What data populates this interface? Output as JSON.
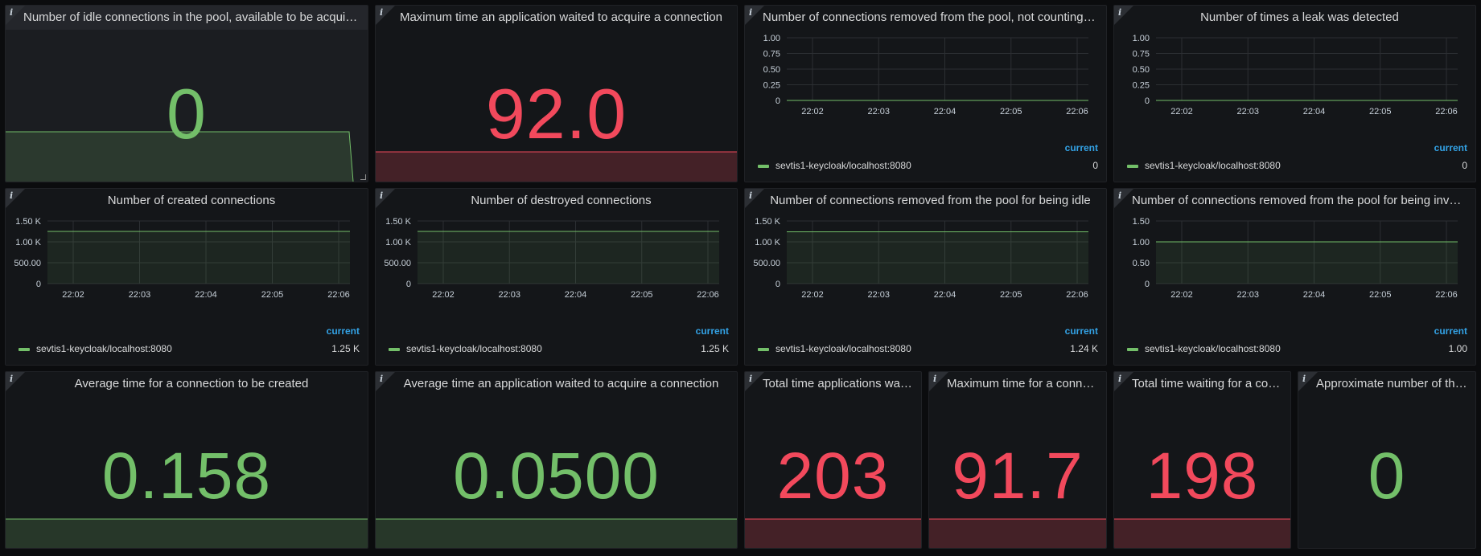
{
  "colors": {
    "green": "#73bf69",
    "red": "#f2495c",
    "blue_current": "#33a2e5"
  },
  "icons": {
    "info": "info-icon"
  },
  "common": {
    "info_glyph": "i",
    "legend_current": "current",
    "series_name": "sevtis1-keycloak/localhost:8080",
    "x_ticks": [
      "22:02",
      "22:03",
      "22:04",
      "22:05",
      "22:06"
    ]
  },
  "panels": {
    "idle": {
      "title": "Number of idle connections in the pool, available to be acquired",
      "value": "0",
      "color": "green",
      "sparkline_level_fraction": 0.0
    },
    "max_wait": {
      "title": "Maximum time an application waited to acquire a connection",
      "value": "92.0",
      "color": "red"
    },
    "removed_not_invalid": {
      "title": "Number of connections removed from the pool, not counting invalid/idle",
      "legend_value": "0"
    },
    "leak": {
      "title": "Number of times a leak was detected",
      "legend_value": "0"
    },
    "created": {
      "title": "Number of created connections",
      "legend_value": "1.25 K"
    },
    "destroyed": {
      "title": "Number of destroyed connections",
      "legend_value": "1.25 K"
    },
    "removed_idle": {
      "title": "Number of connections removed from the pool for being idle",
      "legend_value": "1.24 K"
    },
    "removed_invalid": {
      "title": "Number of connections removed from the pool for being invalid",
      "legend_value": "1.00"
    },
    "avg_create": {
      "title": "Average time for a connection to be created",
      "value": "0.158",
      "color": "green"
    },
    "avg_wait": {
      "title": "Average time an application waited to acquire a connection",
      "value": "0.0500",
      "color": "green"
    },
    "total_wait_apps": {
      "title": "Total time applications waited to acquire a connection",
      "value": "203",
      "color": "red"
    },
    "max_create": {
      "title": "Maximum time for a connection to be created",
      "value": "91.7",
      "color": "red"
    },
    "total_wait_create": {
      "title": "Total time waiting for a connection to be created",
      "value": "198",
      "color": "red"
    },
    "threads": {
      "title": "Approximate number of threads blocked waiting to acquire a connection",
      "value": "0",
      "color": "green"
    }
  },
  "chart_data": [
    {
      "type": "line",
      "title": "Number of connections removed from the pool, not counting invalid/idle",
      "x": [
        "22:02",
        "22:03",
        "22:04",
        "22:05",
        "22:06"
      ],
      "y_ticks": [
        "0",
        "0.25",
        "0.50",
        "0.75",
        "1.00"
      ],
      "ylim": [
        0,
        1
      ],
      "series": [
        {
          "name": "sevtis1-keycloak/localhost:8080",
          "values": [
            0,
            0,
            0,
            0,
            0
          ]
        }
      ]
    },
    {
      "type": "line",
      "title": "Number of times a leak was detected",
      "x": [
        "22:02",
        "22:03",
        "22:04",
        "22:05",
        "22:06"
      ],
      "y_ticks": [
        "0",
        "0.25",
        "0.50",
        "0.75",
        "1.00"
      ],
      "ylim": [
        0,
        1
      ],
      "series": [
        {
          "name": "sevtis1-keycloak/localhost:8080",
          "values": [
            0,
            0,
            0,
            0,
            0
          ]
        }
      ]
    },
    {
      "type": "area",
      "title": "Number of created connections",
      "x": [
        "22:02",
        "22:03",
        "22:04",
        "22:05",
        "22:06"
      ],
      "y_ticks": [
        "0",
        "500.00",
        "1.00 K",
        "1.50 K"
      ],
      "ylim": [
        0,
        1500
      ],
      "series": [
        {
          "name": "sevtis1-keycloak/localhost:8080",
          "values": [
            1250,
            1250,
            1250,
            1250,
            1250
          ]
        }
      ]
    },
    {
      "type": "area",
      "title": "Number of destroyed connections",
      "x": [
        "22:02",
        "22:03",
        "22:04",
        "22:05",
        "22:06"
      ],
      "y_ticks": [
        "0",
        "500.00",
        "1.00 K",
        "1.50 K"
      ],
      "ylim": [
        0,
        1500
      ],
      "series": [
        {
          "name": "sevtis1-keycloak/localhost:8080",
          "values": [
            1250,
            1250,
            1250,
            1250,
            1250
          ]
        }
      ]
    },
    {
      "type": "area",
      "title": "Number of connections removed from the pool for being idle",
      "x": [
        "22:02",
        "22:03",
        "22:04",
        "22:05",
        "22:06"
      ],
      "y_ticks": [
        "0",
        "500.00",
        "1.00 K",
        "1.50 K"
      ],
      "ylim": [
        0,
        1500
      ],
      "series": [
        {
          "name": "sevtis1-keycloak/localhost:8080",
          "values": [
            1240,
            1240,
            1240,
            1240,
            1240
          ]
        }
      ]
    },
    {
      "type": "area",
      "title": "Number of connections removed from the pool for being invalid",
      "x": [
        "22:02",
        "22:03",
        "22:04",
        "22:05",
        "22:06"
      ],
      "y_ticks": [
        "0",
        "0.50",
        "1.00",
        "1.50"
      ],
      "ylim": [
        0,
        1.5
      ],
      "series": [
        {
          "name": "sevtis1-keycloak/localhost:8080",
          "values": [
            1,
            1,
            1,
            1,
            1
          ]
        }
      ]
    }
  ]
}
